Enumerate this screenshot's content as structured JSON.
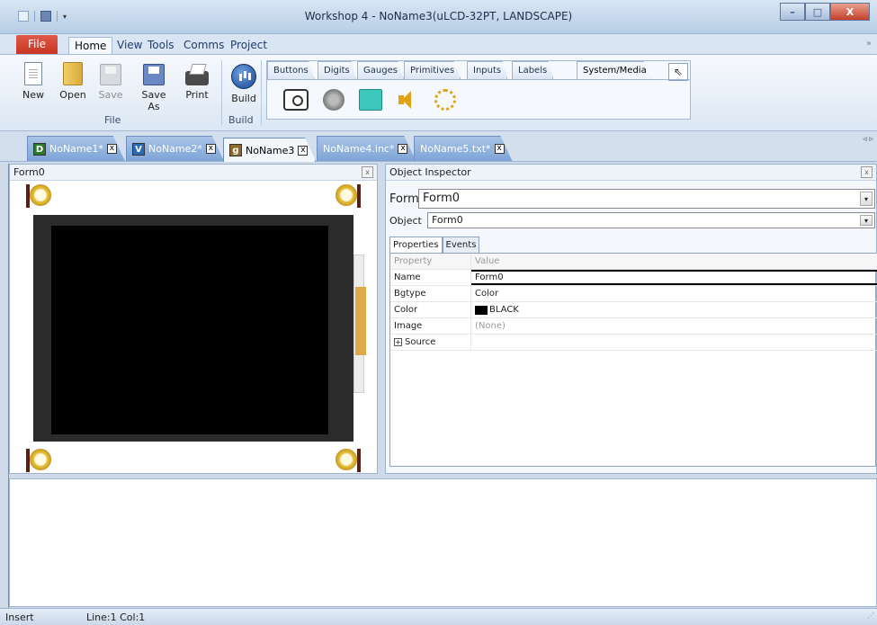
{
  "window": {
    "title": "Workshop 4 - NoName3(uLCD-32PT, LANDSCAPE)",
    "controls": {
      "minimize": "–",
      "maximize": "□",
      "close": "X"
    }
  },
  "quick_access": {
    "dropdown_icon": "▾"
  },
  "ribbon_tabs": [
    "File",
    "Home",
    "View",
    "Tools",
    "Comms",
    "Project"
  ],
  "ribbon_collapse_icon": "»",
  "home": {
    "buttons": [
      {
        "label": "New",
        "icon": "new-file-icon"
      },
      {
        "label": "Open",
        "icon": "open-folder-icon"
      },
      {
        "label": "Save",
        "icon": "save-icon",
        "disabled": true
      },
      {
        "label": "Save As",
        "icon": "save-as-icon"
      },
      {
        "label": "Print",
        "icon": "printer-icon"
      },
      {
        "label": "Build",
        "icon": "build-icon"
      }
    ],
    "groups": [
      "File",
      "Build"
    ]
  },
  "palette": {
    "tabs": [
      "Buttons",
      "Digits",
      "Gauges",
      "Primitives",
      "Inputs",
      "Labels",
      "System/Media"
    ],
    "active_tab": "System/Media",
    "pointer_icon": "⇖",
    "widgets": [
      "camera-image-icon",
      "video-reel-icon",
      "rectangle-widget-icon",
      "sound-icon",
      "timer-icon"
    ]
  },
  "doc_tabs": [
    {
      "badge": "D",
      "label": "NoName1*",
      "close": "x"
    },
    {
      "badge": "V",
      "label": "NoName2*",
      "close": "x"
    },
    {
      "badge": "g",
      "label": "NoName3",
      "close": "x",
      "active": true
    },
    {
      "label": "NoName4.inc*",
      "close": "x"
    },
    {
      "label": "NoName5.txt*",
      "close": "x"
    }
  ],
  "doc_tabs_scroll": "◃ ▹",
  "form_panel": {
    "title": "Form0",
    "close": "x"
  },
  "inspector": {
    "title": "Object Inspector",
    "close": "x",
    "form_label": "Form",
    "form_value": "Form0",
    "object_label": "Object",
    "object_value": "Form0",
    "dropdown_icon": "▾",
    "tabs": [
      "Properties",
      "Events"
    ],
    "columns": [
      "Property",
      "Value"
    ],
    "rows": [
      {
        "property": "Name",
        "value": "Form0"
      },
      {
        "property": "Bgtype",
        "value": "Color"
      },
      {
        "property": "Color",
        "value": "BLACK",
        "swatch": "#000000"
      },
      {
        "property": "Image",
        "value": "(None)"
      },
      {
        "property": "Source",
        "value": "",
        "expand": "+"
      }
    ]
  },
  "status": {
    "mode": "Insert",
    "position": "Line:1 Col:1",
    "grip": "⋰"
  }
}
